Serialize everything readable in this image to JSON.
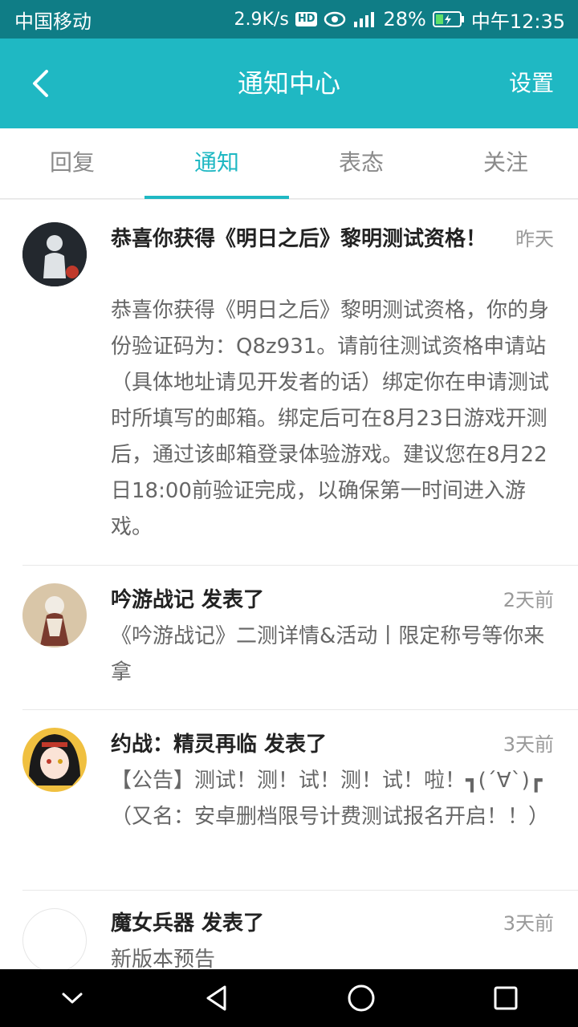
{
  "status_bar": {
    "carrier": "中国移动",
    "speed": "2.9K/s",
    "hd_badge": "HD",
    "battery": "28%",
    "time": "中午12:35"
  },
  "header": {
    "title": "通知中心",
    "settings_label": "设置"
  },
  "tabs": [
    {
      "label": "回复",
      "active": false
    },
    {
      "label": "通知",
      "active": true
    },
    {
      "label": "表态",
      "active": false
    },
    {
      "label": "关注",
      "active": false
    }
  ],
  "notifications": [
    {
      "title": "恭喜你获得《明日之后》黎明测试资格！",
      "time": "昨天",
      "body": "恭喜你获得《明日之后》黎明测试资格，你的身份验证码为：Q8z931。请前往测试资格申请站（具体地址请见开发者的话）绑定你在申请测试时所填写的邮箱。绑定后可在8月23日游戏开测后，通过该邮箱登录体验游戏。建议您在8月22日18:00前验证完成，以确保第一时间进入游戏。"
    },
    {
      "title": "吟游战记 发表了",
      "time": "2天前",
      "body": "《吟游战记》二测详情&活动丨限定称号等你来拿"
    },
    {
      "title": "约战：精灵再临 发表了",
      "time": "3天前",
      "body": "【公告】测试！测！试！测！试！啦！┓(´∀`)┏（又名：安卓删档限号计费测试报名开启！！）"
    },
    {
      "title": "魔女兵器 发表了",
      "time": "3天前",
      "body": "新版本预告"
    }
  ],
  "colors": {
    "status_bar": "#0f7d86",
    "header": "#1fb8c3",
    "accent": "#1fb8c3"
  },
  "icons": {
    "back": "chevron-left-icon",
    "nav_back": "triangle-back-icon",
    "nav_home": "circle-home-icon",
    "nav_recent": "square-recent-icon",
    "nav_collapse": "chevron-down-icon"
  }
}
